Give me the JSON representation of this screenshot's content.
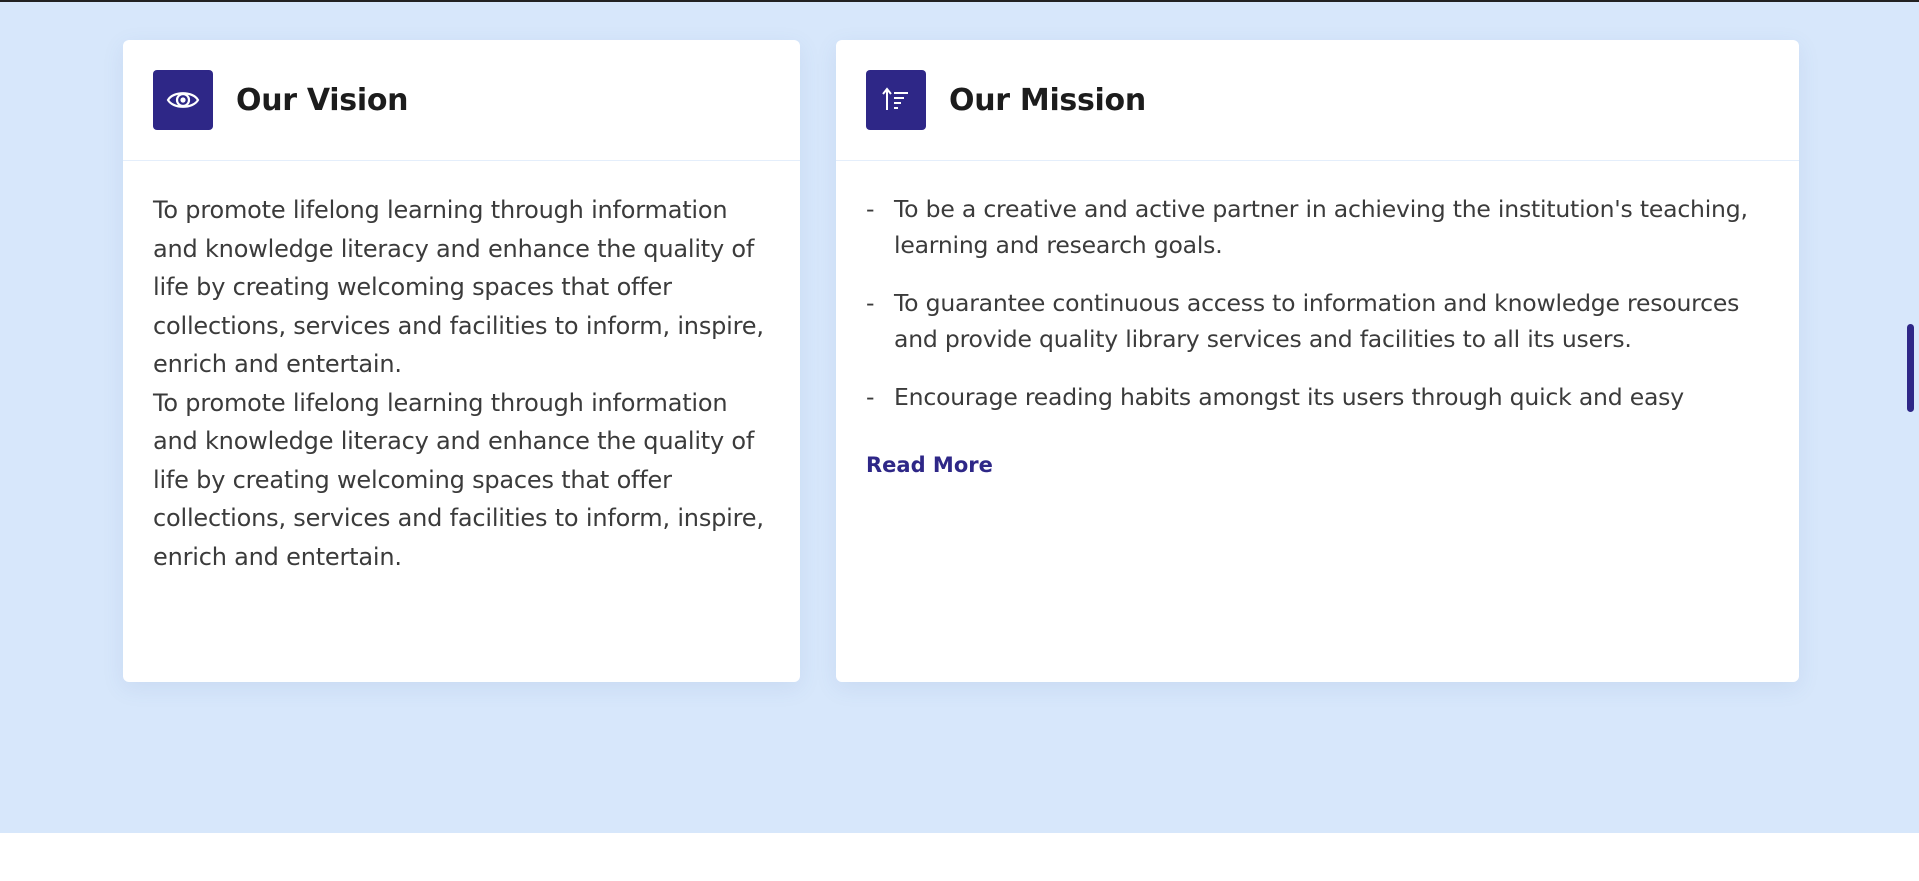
{
  "vision": {
    "title": "Our Vision",
    "icon": "eye-icon",
    "paragraphs": [
      "To promote lifelong learning through information and knowledge literacy and enhance the quality of life by creating welcoming spaces that offer collections, services and facilities to inform, inspire, enrich and entertain.",
      "To promote lifelong learning through information and knowledge literacy and enhance the quality of life by creating welcoming spaces that offer collections, services and facilities to inform, inspire, enrich and entertain."
    ]
  },
  "mission": {
    "title": "Our Mission",
    "icon": "sort-ascending-icon",
    "items": [
      {
        "dash": "-",
        "text": "To be a creative and active partner in achieving the institution's teaching, learning and research goals."
      },
      {
        "dash": "-",
        "text": "To guarantee continuous access to information and knowledge resources and provide quality library services and facilities to all its users."
      },
      {
        "dash": "-",
        "text": "Encourage reading habits amongst its users through quick and easy"
      }
    ],
    "read_more": "Read More"
  },
  "colors": {
    "accent": "#2e2787",
    "background": "#d7e7fb",
    "card": "#ffffff",
    "text": "#3b3b3b",
    "title": "#1c1c1c"
  }
}
